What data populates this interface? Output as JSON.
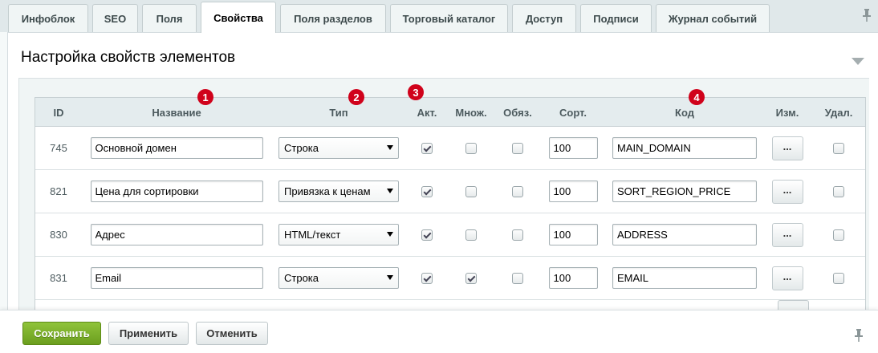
{
  "tabs": [
    {
      "label": "Инфоблок",
      "active": false
    },
    {
      "label": "SEO",
      "active": false
    },
    {
      "label": "Поля",
      "active": false
    },
    {
      "label": "Свойства",
      "active": true
    },
    {
      "label": "Поля разделов",
      "active": false
    },
    {
      "label": "Торговый каталог",
      "active": false
    },
    {
      "label": "Доступ",
      "active": false
    },
    {
      "label": "Подписи",
      "active": false
    },
    {
      "label": "Журнал событий",
      "active": false
    }
  ],
  "section": {
    "title": "Настройка свойств элементов"
  },
  "table": {
    "headers": {
      "id": "ID",
      "name": "Название",
      "type": "Тип",
      "active": "Акт.",
      "multiple": "Множ.",
      "required": "Обяз.",
      "sort": "Сорт.",
      "code": "Код",
      "edit": "Изм.",
      "delete": "Удал."
    },
    "rows": [
      {
        "id": "745",
        "name": "Основной домен",
        "type": "Строка",
        "active": true,
        "multiple": false,
        "required": false,
        "sort": "100",
        "code": "MAIN_DOMAIN",
        "delete": false
      },
      {
        "id": "821",
        "name": "Цена для сортировки",
        "type": "Привязка к ценам",
        "active": true,
        "multiple": false,
        "required": false,
        "sort": "100",
        "code": "SORT_REGION_PRICE",
        "delete": false
      },
      {
        "id": "830",
        "name": "Адрес",
        "type": "HTML/текст",
        "active": true,
        "multiple": false,
        "required": false,
        "sort": "100",
        "code": "ADDRESS",
        "delete": false
      },
      {
        "id": "831",
        "name": "Email",
        "type": "Строка",
        "active": true,
        "multiple": true,
        "required": false,
        "sort": "100",
        "code": "EMAIL",
        "delete": false
      }
    ],
    "edit_button_label": "..."
  },
  "markers": [
    "1",
    "2",
    "3",
    "4"
  ],
  "buttons": {
    "save": "Сохранить",
    "apply": "Применить",
    "cancel": "Отменить"
  },
  "colors": {
    "save_green": "#7bb02c",
    "marker_red": "#d0021b",
    "tab_active": "#ffffff"
  }
}
